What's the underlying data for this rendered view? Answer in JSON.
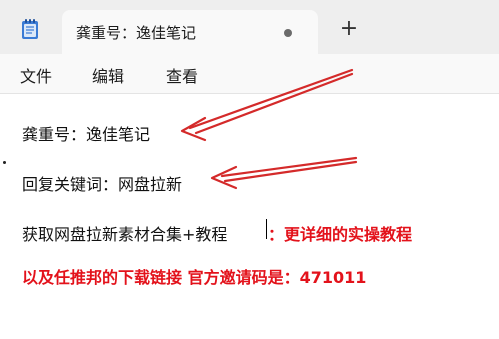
{
  "tab": {
    "title": "龚重号：逸佳笔记",
    "new_tab": "+"
  },
  "menu": {
    "file": "文件",
    "edit": "编辑",
    "view": "查看"
  },
  "content": {
    "line1": "龚重号：逸佳笔记",
    "line2": "回复关键词：网盘拉新",
    "line3": "获取网盘拉新素材合集+教程",
    "line3_red": "：更详细的实操教程",
    "line4_red": "以及任推邦的下载链接  官方邀请码是：471011"
  },
  "colors": {
    "annotation": "#e3121b",
    "arrow": "#d42a2a"
  }
}
